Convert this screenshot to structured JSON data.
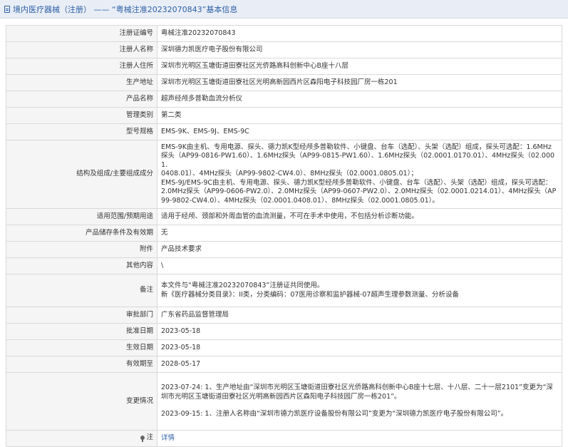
{
  "header": {
    "title": "境内医疗器械（注册） —— “粤械注准20232070843”基本信息"
  },
  "rows": [
    {
      "label": "注册证编号",
      "value": "粤械注准20232070843"
    },
    {
      "label": "注册人名称",
      "value": "深圳德力凯医疗电子股份有限公司"
    },
    {
      "label": "注册人住所",
      "value": "深圳市光明区玉塘街道田寮社区光侨路高科创新中心B座十八层"
    },
    {
      "label": "生产地址",
      "value": "深圳市光明区玉塘街道田寮社区光明高新园西片区森阳电子科技园厂房一栋201"
    },
    {
      "label": "产品名称",
      "value": "超声经颅多普勒血流分析仪"
    },
    {
      "label": "管理类别",
      "value": "第二类"
    },
    {
      "label": "型号规格",
      "value": "EMS-9K、EMS-9J、EMS-9C"
    }
  ],
  "structure": {
    "label": "结构及组成/主要组成成分",
    "lines": [
      "EMS-9K由主机、专用电源、探头、德力凯K型经颅多普勒软件、小键盘、台车（选配）、头架（选配）组成，探头可选配：1.6MHz",
      "探头（AP99-0816-PW1.60）、1.6MHz探头（AP99-0815-PW1.60）、1.6MHz探头（02.0001.0170.01）、4MHz探头（02.0001.",
      "0408.01）、4MHz探头（AP99-9802-CW4.0）、8MHz探头（02.0001.0805.01）；",
      "EMS-9J/EMS-9C由主机、专用电源、探头、德力凯K型经颅多普勒软件、小键盘、台车（选配）、头架（选配）组成，探头可选配：",
      "2.0MHz探头（AP99-0606-PW2.0）、2.0MHz探头（AP99-0607-PW2.0）、2.0MHz探头（02.0001.0214.01）、4MHz探头（AP",
      "99-9802-CW4.0）、4MHz探头（02.0001.0408.01）、8MHz探头（02.0001.0805.01）。"
    ]
  },
  "rows2": [
    {
      "label": "适用范围/预期用途",
      "value": "适用于经颅、颈部和外周血管的血流测量，不可在手术中使用，不包括分析诊断功能。"
    },
    {
      "label": "产品储存条件及有效期",
      "value": "无"
    },
    {
      "label": "附件",
      "value": "产品技术要求"
    },
    {
      "label": "其他内容",
      "value": "\\"
    }
  ],
  "remark": {
    "label": "备注",
    "lines": [
      "本文件与“粤械注准20232070843”注册证共同使用。",
      "新《医疗器械分类目录》：II类，分类编码：07医用诊察和监护器械-07超声生理参数测量、分析设备"
    ]
  },
  "rows3": [
    {
      "label": "审批部门",
      "value": "广东省药品监督管理局"
    },
    {
      "label": "批准日期",
      "value": "2023-05-18"
    },
    {
      "label": "生效日期",
      "value": "2023-05-18"
    },
    {
      "label": "有效期至",
      "value": "2028-05-17"
    }
  ],
  "change": {
    "label": "变更情况",
    "lines": [
      "2023-07-24: 1、生产地址由“深圳市光明区玉塘街道田寮社区光侨路高科创新中心B座十七层、十八层、二十一层2101”变更为“深",
      "圳市光明区玉塘街道田寮社区光明高新园西片区森阳电子科技园厂房一栋201”。",
      "2023-09-15: 1、注册人名称由“深圳市德力凯医疗设备股份有限公司”变更为“深圳德力凯医疗电子股份有限公司”。"
    ]
  },
  "note": {
    "label": "注",
    "link": "详情"
  }
}
